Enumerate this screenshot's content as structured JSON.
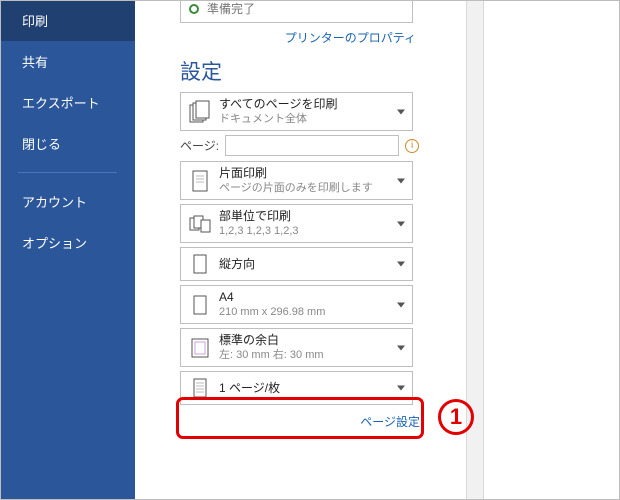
{
  "sidebar": {
    "items": [
      {
        "label": "印刷",
        "selected": true
      },
      {
        "label": "共有"
      },
      {
        "label": "エクスポート"
      },
      {
        "label": "閉じる"
      }
    ],
    "items2": [
      {
        "label": "アカウント"
      },
      {
        "label": "オプション"
      }
    ]
  },
  "printer_status": {
    "text": "準備完了"
  },
  "links": {
    "printer_props": "プリンターのプロパティ",
    "page_setup": "ページ設定"
  },
  "section_title": "設定",
  "pages_label": "ページ:",
  "options": {
    "print_all": {
      "line1": "すべてのページを印刷",
      "line2": "ドキュメント全体"
    },
    "duplex": {
      "line1": "片面印刷",
      "line2": "ページの片面のみを印刷します"
    },
    "collate": {
      "line1": "部単位で印刷",
      "line2": "1,2,3    1,2,3    1,2,3"
    },
    "orient": {
      "line1": "縦方向"
    },
    "size": {
      "line1": "A4",
      "line2": "210 mm x 296.98 mm"
    },
    "margin": {
      "line1": "標準の余白",
      "line2": "左: 30 mm   右: 30 mm"
    },
    "sheets": {
      "line1": "1 ページ/枚"
    }
  },
  "annotation": {
    "number": "1"
  }
}
